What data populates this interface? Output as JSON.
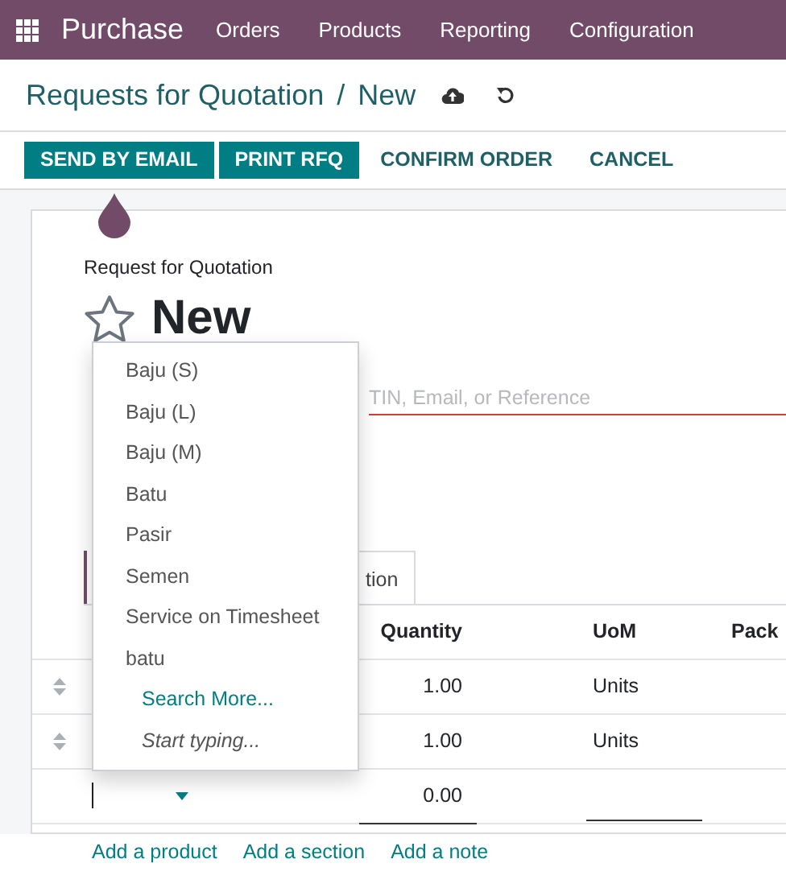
{
  "navbar": {
    "app": "Purchase",
    "menu": [
      "Orders",
      "Products",
      "Reporting",
      "Configuration"
    ]
  },
  "breadcrumb": {
    "parent": "Requests for Quotation",
    "separator": "/",
    "current": "New"
  },
  "actions": [
    {
      "label": "SEND BY EMAIL",
      "kind": "primary"
    },
    {
      "label": "PRINT RFQ",
      "kind": "primary"
    },
    {
      "label": "CONFIRM ORDER",
      "kind": "secondary"
    },
    {
      "label": "CANCEL",
      "kind": "secondary"
    }
  ],
  "form": {
    "subtitle": "Request for Quotation",
    "title": "New",
    "starred": false,
    "vendor_required": true,
    "vendor_placeholder": "TIN, Email, or Reference"
  },
  "tabs": [
    {
      "label": "tion",
      "selected": false
    }
  ],
  "table": {
    "columns": [
      "Quantity",
      "UoM",
      "Pack"
    ],
    "rows": [
      {
        "kind": "line",
        "quantity": "1.00",
        "uom": "Units"
      },
      {
        "kind": "line",
        "quantity": "1.00",
        "uom": "Units"
      },
      {
        "kind": "editing",
        "quantity": "0.00"
      }
    ]
  },
  "add_links": [
    "Add a product",
    "Add a section",
    "Add a note"
  ],
  "dropdown": [
    {
      "label": "Baju (S)",
      "kind": "option"
    },
    {
      "label": "Baju (L)",
      "kind": "option"
    },
    {
      "label": "Baju (M)",
      "kind": "option"
    },
    {
      "label": "Batu",
      "kind": "option"
    },
    {
      "label": "Pasir",
      "kind": "option"
    },
    {
      "label": "Semen",
      "kind": "option"
    },
    {
      "label": "Service on Timesheet",
      "kind": "option"
    },
    {
      "label": "batu",
      "kind": "option"
    },
    {
      "label": "Search More...",
      "kind": "action"
    },
    {
      "label": "Start typing...",
      "kind": "hint"
    }
  ]
}
